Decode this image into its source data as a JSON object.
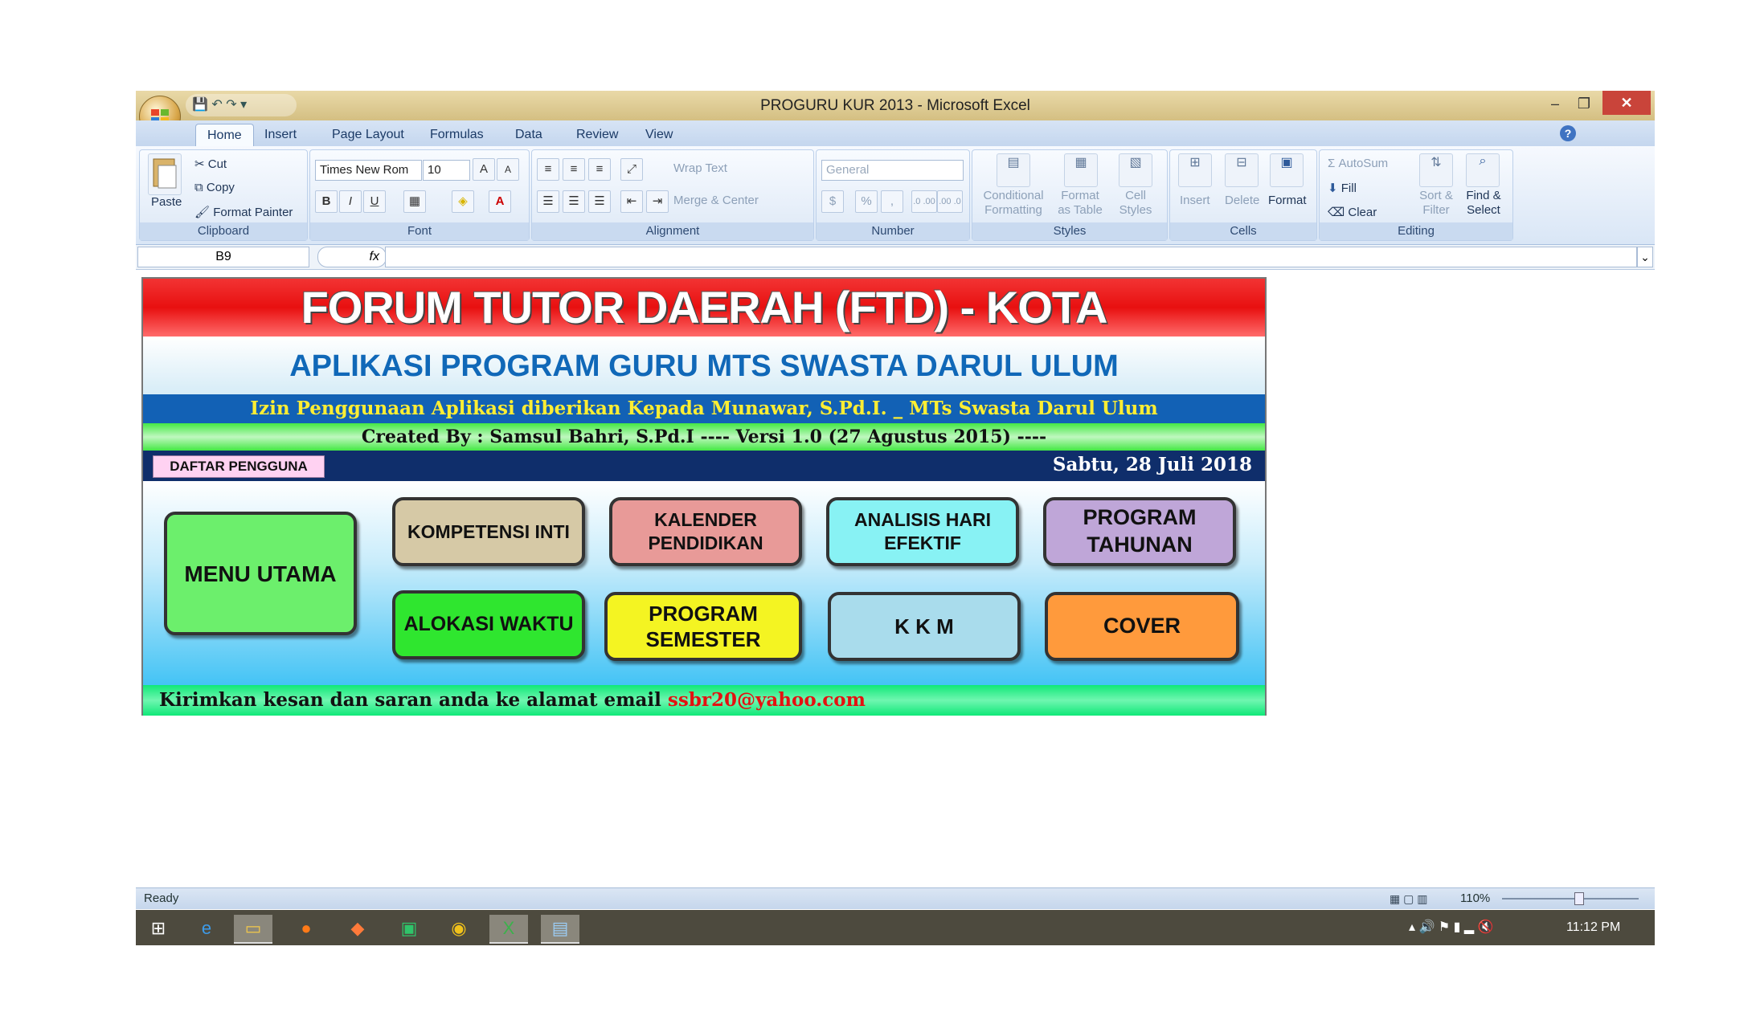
{
  "window": {
    "title": "PROGURU KUR 2013 - Microsoft Excel",
    "minimize_glyph": "–",
    "restore_glyph": "❐",
    "close_glyph": "✕",
    "qat_glyphs": "💾 ↶ ↷ ▾"
  },
  "ribbon_tabs": [
    "Home",
    "Insert",
    "Page Layout",
    "Formulas",
    "Data",
    "Review",
    "View"
  ],
  "ribbon": {
    "clipboard": {
      "label": "Clipboard",
      "paste": "Paste",
      "cut": "Cut",
      "copy": "Copy",
      "format_painter": "Format Painter"
    },
    "font": {
      "label": "Font",
      "font_name": "Times New Rom",
      "font_size": "10",
      "bold": "B",
      "italic": "I",
      "underline": "U"
    },
    "alignment": {
      "label": "Alignment",
      "wrap_text": "Wrap Text",
      "merge_center": "Merge & Center"
    },
    "number": {
      "label": "Number",
      "format": "General",
      "currency": "$",
      "percent": "%",
      "comma": ",",
      "inc_dec": ".0 .00",
      "dec_dec": ".00 .0"
    },
    "styles": {
      "label": "Styles",
      "conditional_1": "Conditional",
      "conditional_2": "Formatting",
      "format_table_1": "Format",
      "format_table_2": "as Table",
      "cell_styles_1": "Cell",
      "cell_styles_2": "Styles"
    },
    "cells": {
      "label": "Cells",
      "insert": "Insert",
      "delete": "Delete",
      "format": "Format"
    },
    "editing": {
      "label": "Editing",
      "autosum": "AutoSum",
      "fill": "Fill",
      "clear": "Clear",
      "sort_1": "Sort &",
      "sort_2": "Filter",
      "find_1": "Find &",
      "find_2": "Select"
    }
  },
  "formula_bar": {
    "name_box": "B9",
    "fx": "fx"
  },
  "sheet": {
    "banner": "FORUM TUTOR DAERAH (FTD) - KOTA LHOKSEUMAWE",
    "subtitle": "APLIKASI PROGRAM GURU MTS SWASTA DARUL ULUM",
    "izin": "Izin Penggunaan Aplikasi diberikan Kepada Munawar, S.Pd.I. _ MTs Swasta Darul Ulum",
    "created": "Created By : Samsul Bahri, S.Pd.I ---- Versi 1.0 (27 Agustus 2015) ----",
    "daftar_pengguna": "DAFTAR PENGGUNA",
    "date": "Sabtu, 28 Juli 2018",
    "menu_utama": "MENU UTAMA",
    "buttons": {
      "kompetensi_inti": "KOMPETENSI INTI",
      "kalender_pendidikan": "KALENDER PENDIDIKAN",
      "analisis_hari_efektif": "ANALISIS HARI EFEKTIF",
      "program_tahunan": "PROGRAM TAHUNAN",
      "alokasi_waktu": "ALOKASI WAKTU",
      "program_semester": "PROGRAM SEMESTER",
      "kkm": "K K M",
      "cover": "COVER"
    },
    "email_prefix": "Kirimkan kesan dan saran anda ke alamat email ",
    "email": "ssbr20@yahoo.com"
  },
  "status": {
    "ready": "Ready",
    "zoom": "110%"
  },
  "taskbar": {
    "clock": "11:12 PM"
  },
  "colors": {
    "banner_red": "#e81010",
    "subtitle_blue": "#1068b8",
    "izin_yellow": "#ffee33",
    "menu_green": "#6cef6c",
    "kompetensi": "#d6c9a6",
    "kalender": "#e89a98",
    "analisis": "#88f2f4",
    "program_tahunan": "#bfa6d8",
    "alokasi": "#2fe62f",
    "program_semester": "#f4f422",
    "kkm": "#a9dcec",
    "cover": "#ff9a3c"
  }
}
